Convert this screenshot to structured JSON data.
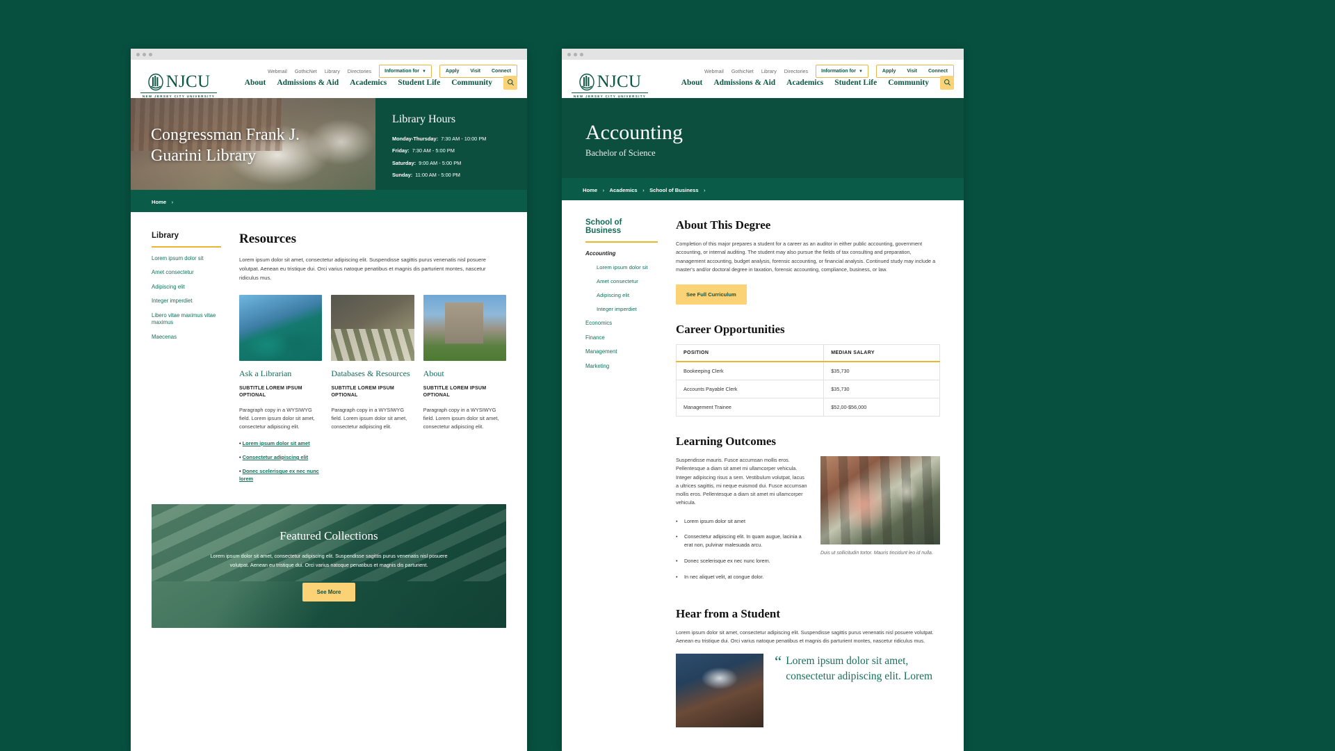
{
  "site": {
    "logo_word": "NJCU",
    "logo_sub": "NEW JERSEY CITY UNIVERSITY",
    "utility_links": [
      "Webmail",
      "GothicNet",
      "Library",
      "Directories"
    ],
    "information_for": "Information for",
    "action_links": [
      "Apply",
      "Visit",
      "Connect"
    ],
    "main_nav": [
      "About",
      "Admissions & Aid",
      "Academics",
      "Student Life",
      "Community"
    ],
    "search_icon": "search-icon",
    "accent_gold": "#fbd276",
    "brand_green": "#0b5742",
    "hero_green": "#0d4f3f",
    "crumb_green": "#0a5c48",
    "link_green": "#127059"
  },
  "library_window": {
    "hero": {
      "title_line1": "Congressman Frank J.",
      "title_line2": "Guarini Library",
      "hours_title": "Library Hours",
      "hours": [
        {
          "label": "Monday-Thursday:",
          "value": "7:30 AM - 10:00 PM"
        },
        {
          "label": "Friday:",
          "value": "7:30 AM - 5:00 PM"
        },
        {
          "label": "Saturday:",
          "value": "9:00 AM - 5:00 PM"
        },
        {
          "label": "Sunday:",
          "value": "11:00 AM - 5:00 PM"
        }
      ]
    },
    "breadcrumb": {
      "items": [
        "Home"
      ],
      "separator": "›"
    },
    "sidebar": {
      "heading": "Library",
      "links": [
        "Lorem ipsum dolor sit",
        "Amet consectetur",
        "Adipiscing elit",
        "Integer imperdiet",
        "Libero vitae maximus vitae maximus",
        "Maecenas"
      ]
    },
    "resources": {
      "heading": "Resources",
      "intro": "Lorem ipsum dolor sit amet, consectetur adipiscing elit. Suspendisse sagittis purus venenatis nisl posuere volutpat. Aenean eu tristique dui. Orci varius natoque penatibus et magnis dis parturient montes, nascetur ridiculus mus.",
      "cards": [
        {
          "image": "students-selfie-photo",
          "title": "Ask a Librarian",
          "subtitle": "SUBTITLE LOREM IPSUM OPTIONAL",
          "body": "Paragraph copy in a WYSIWYG field. Lorem ipsum dolor sit amet, consectetur adipiscing elit.",
          "links": [
            "Lorem ipsum dolor sit amet",
            "Consectetur adipiscing elit",
            "Donec scelerisque ex nec nunc lorem"
          ]
        },
        {
          "image": "classroom-table-photo",
          "title": "Databases & Resources",
          "subtitle": "SUBTITLE LOREM IPSUM OPTIONAL",
          "body": "Paragraph copy in a WYSIWYG field. Lorem ipsum dolor sit amet, consectetur adipiscing elit.",
          "links": []
        },
        {
          "image": "campus-tower-photo",
          "title": "About",
          "subtitle": "SUBTITLE LOREM IPSUM OPTIONAL",
          "body": "Paragraph copy in a WYSIWYG field. Lorem ipsum dolor sit amet, consectetur adipiscing elit.",
          "links": []
        }
      ]
    },
    "featured": {
      "heading": "Featured Collections",
      "body": "Lorem ipsum dolor sit amet, consectetur adipiscing elit. Suspendisse sagittis purus venenatis nisl posuere volutpat. Aenean eu tristique dui. Orci varius natoque penatibus et magnis dis parturient.",
      "button": "See More"
    }
  },
  "degree_window": {
    "hero": {
      "title": "Accounting",
      "subtitle": "Bachelor of Science"
    },
    "breadcrumb": {
      "items": [
        "Home",
        "Academics",
        "School of Business"
      ],
      "separator": "›"
    },
    "sidebar": {
      "heading": "School of Business",
      "current": "Accounting",
      "sub_links": [
        "Lorem ipsum dolor sit",
        "Amet consectetur",
        "Adipiscing elit",
        "Integer imperdiet"
      ],
      "links": [
        "Economics",
        "Finance",
        "Management",
        "Marketing"
      ]
    },
    "about": {
      "heading": "About This Degree",
      "body": "Completion of this major prepares a student for a career as an auditor in either public accounting, government accounting, or internal auditing. The student may also pursue the fields of tax consulting and preparation, management accounting, budget analysis, forensic accounting, or financial analysis. Continued study may include a master's and/or doctoral degree in taxation, forensic accounting, compliance, business, or law.",
      "button": "See Full Curriculum"
    },
    "careers": {
      "heading": "Career Opportunities",
      "columns": [
        "POSITION",
        "MEDIAN SALARY"
      ],
      "rows": [
        [
          "Bookeeping Clerk",
          "$35,730"
        ],
        [
          "Accounts Payable Clerk",
          "$35,730"
        ],
        [
          "Management Trainee",
          "$52,00-$56,000"
        ]
      ]
    },
    "outcomes": {
      "heading": "Learning Outcomes",
      "body": "Suspendisse mauris. Fusce accumsan mollis eros. Pellentesque a diam sit amet mi ullamcorper vehicula. Integer adipiscing risus a sem. Vestibulum volutpat, lacus a ultrices sagittis, mi neque euismod dui. Fusce accumsan mollis eros. Pellentesque a diam sit amet mi ullamcorper vehicula.",
      "bullets": [
        "Lorem ipsum dolor sit amet",
        "Consectetur adipiscing elit. In quam augue, lacinia a erat non, pulvinar malesuada arcu.",
        "Donec scelerisque ex nec nunc lorem.",
        "In nec aliquet velit, at congue dolor."
      ],
      "image": "mural-portrait-photo",
      "caption": "Duis ut sollicitudin tortor. Mauris tincidunt leo id nulla."
    },
    "student": {
      "heading": "Hear from a Student",
      "body": "Lorem ipsum dolor sit amet, consectetur adipiscing elit. Suspendisse sagittis purus venenatis nisl posuere volutpat. Aenean eu tristique dui. Orci varius natoque penatibus et magnis dis parturient montes, nascetur ridiculus mus.",
      "image": "student-portrait-photo",
      "quote_mark": "“",
      "quote": "Lorem ipsum dolor sit amet, consectetur adipiscing elit. Lorem"
    }
  }
}
